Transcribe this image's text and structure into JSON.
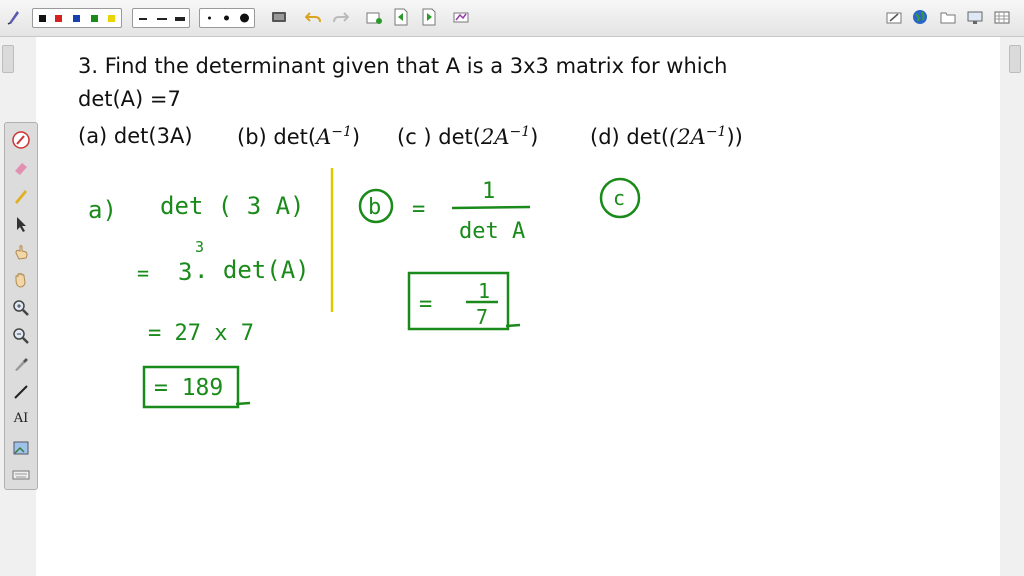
{
  "toolbar": {
    "colors": [
      "#111111",
      "#d62020",
      "#1a3fb0",
      "#1a8a1a",
      "#e8d400"
    ],
    "icons": [
      "pen-icon",
      "undo-icon",
      "redo-icon",
      "new-page-icon",
      "prev-page-icon",
      "next-page-icon",
      "link-icon",
      "display-icon",
      "globe-icon",
      "folder-icon",
      "screen-icon",
      "grid-icon"
    ]
  },
  "question": {
    "line1": "3. Find the determinant given that A is a 3x3 matrix for which",
    "line2": "det(A) =7",
    "part_a": "(a) det(3A)",
    "part_b_prefix": "(b) det(",
    "part_b_math": "A",
    "part_b_exp": "−1",
    "part_b_suffix": ")",
    "part_c_prefix": "(c ) det(",
    "part_c_math": "2A",
    "part_c_exp": "−1",
    "part_c_suffix": ")",
    "part_d_prefix": "(d)  det(",
    "part_d_math": "(2A",
    "part_d_exp": "−1",
    "part_d_suffix": "))"
  },
  "handwriting": {
    "a_label": "a)",
    "a_line1": "det ( 3 A)",
    "a_eq1": "=",
    "a_base": "3",
    "a_exp": "3",
    "a_line2": ". det(A)",
    "a_line3": "= 27 x 7",
    "a_answer": "= 189",
    "b_label": "b",
    "b_eq": "=",
    "b_num": "1",
    "b_den": "det A",
    "b_answer_eq": "=",
    "b_answer_num": "1",
    "b_answer_den": "7",
    "c_label": "c"
  },
  "palette_tools": [
    "pen-tool-icon",
    "eraser-icon",
    "highlighter-icon",
    "select-arrow-icon",
    "pointer-hand-icon",
    "pan-hand-icon",
    "zoom-in-icon",
    "zoom-out-icon",
    "dropper-icon",
    "line-tool-icon",
    "text-tool-icon",
    "image-tool-icon",
    "keyboard-icon"
  ],
  "text_tool_label": "AI"
}
